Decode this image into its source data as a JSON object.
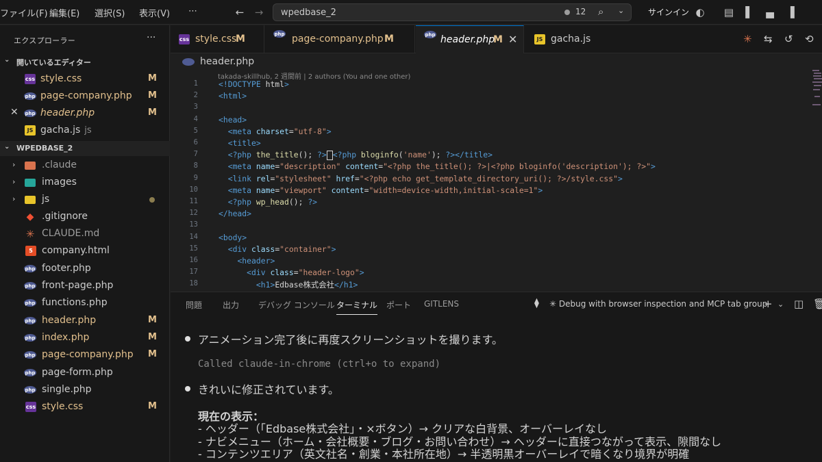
{
  "menu": [
    "ファイル(F)",
    "編集(E)",
    "選択(S)",
    "表示(V)",
    "⋯"
  ],
  "command_center": {
    "text": "wpedbase_2",
    "notification_count": "12"
  },
  "signin_label": "サインイン",
  "sidebar": {
    "title": "エクスプローラー",
    "more": "···",
    "open_editors_label": "開いているエディター",
    "open_editors": [
      {
        "name": "style.css",
        "icon": "css-icon",
        "status": "M"
      },
      {
        "name": "page-company.php",
        "icon": "php-icon",
        "status": "M"
      },
      {
        "name": "header.php",
        "icon": "php-icon",
        "status": "M",
        "active": true
      },
      {
        "name": "gacha.js",
        "icon": "js-icon",
        "desc": "js",
        "status": ""
      }
    ],
    "project_label": "WPEDBASE_2",
    "tree": [
      {
        "name": ".claude",
        "type": "folder",
        "icon": "folder-claude-icon"
      },
      {
        "name": "images",
        "type": "folder",
        "icon": "folder-images-icon"
      },
      {
        "name": "js",
        "type": "folder",
        "icon": "folder-js-icon",
        "dot": true
      },
      {
        "name": ".gitignore",
        "icon": "git-icon",
        "status": ""
      },
      {
        "name": "CLAUDE.md",
        "icon": "claude-icon",
        "status": ""
      },
      {
        "name": "company.html",
        "icon": "html-icon",
        "status": ""
      },
      {
        "name": "footer.php",
        "icon": "php-icon",
        "status": ""
      },
      {
        "name": "front-page.php",
        "icon": "php-icon",
        "status": ""
      },
      {
        "name": "functions.php",
        "icon": "php-icon",
        "status": ""
      },
      {
        "name": "header.php",
        "icon": "php-icon",
        "status": "M"
      },
      {
        "name": "index.php",
        "icon": "php-icon",
        "status": "M"
      },
      {
        "name": "page-company.php",
        "icon": "php-icon",
        "status": "M"
      },
      {
        "name": "page-form.php",
        "icon": "php-icon",
        "status": ""
      },
      {
        "name": "single.php",
        "icon": "php-icon",
        "status": ""
      },
      {
        "name": "style.css",
        "icon": "css-icon",
        "status": "M"
      }
    ]
  },
  "tabs": [
    {
      "name": "style.css",
      "icon": "css-icon",
      "status": "M"
    },
    {
      "name": "page-company.php",
      "icon": "php-icon",
      "status": "M"
    },
    {
      "name": "header.php",
      "icon": "php-icon",
      "status": "M",
      "active": true
    },
    {
      "name": "gacha.js",
      "icon": "js-icon",
      "status": ""
    }
  ],
  "breadcrumb": "header.php",
  "blame": "takada-skillhub, 2 週間前 | 2 authors (You and one other)",
  "code_lines": [
    "<!DOCTYPE html>",
    "<html>",
    "",
    "<head>",
    "  <meta charset=\"utf-8\">",
    "  <title>",
    "  <?php the_title(); ?>|<?php bloginfo('name'); ?></title>",
    "  <meta name=\"description\" content=\"<?php the_title(); ?>|<?php bloginfo('description'); ?>\">",
    "  <link rel=\"stylesheet\" href=\"<?php echo get_template_directory_uri(); ?>/style.css\">",
    "  <meta name=\"viewport\" content=\"width=device-width,initial-scale=1\">",
    "  <?php wp_head(); ?>",
    "</head>",
    "",
    "<body>",
    "  <div class=\"container\">",
    "    <header>",
    "      <div class=\"header-logo\">",
    "        <h1>Edbase株式会社</h1>"
  ],
  "panel": {
    "tabs": [
      "問題",
      "出力",
      "デバッグ コンソール",
      "ターミナル",
      "ポート",
      "GITLENS"
    ],
    "active_tab": "ターミナル",
    "terminal_name": "✳ Debug with browser inspection and MCP tab group"
  },
  "terminal": {
    "line1": "アニメーション完了後に再度スクリーンショットを撮ります。",
    "line2": "Called claude-in-chrome (ctrl+o to expand)",
    "line3": "きれいに修正されています。",
    "heading": "現在の表示：",
    "items": [
      "- ヘッダー（「Edbase株式会社」・×ボタン）→ クリアな白背景、オーバーレイなし",
      "- ナビメニュー（ホーム・会社概要・ブログ・お問い合わせ）→ ヘッダーに直接つながって表示、隙間なし",
      "- コンテンツエリア（英文社名・創業・本社所在地）→ 半透明黒オーバーレイで暗くなり境界が明確"
    ]
  },
  "colors": {
    "accent": "#0078d4",
    "modified": "#e2c08d",
    "background": "#1f1f1f",
    "sidebar": "#181818"
  }
}
